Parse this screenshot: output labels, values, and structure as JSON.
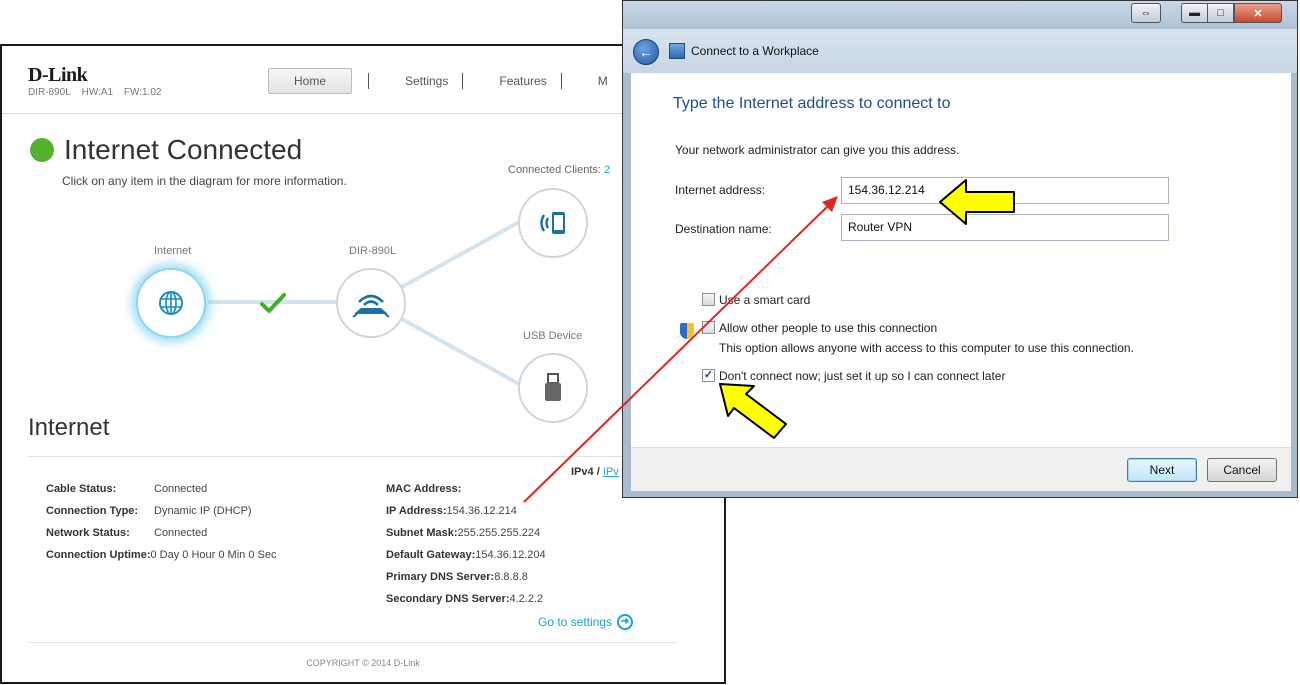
{
  "router": {
    "brand": "D-Link",
    "model": "DIR-890L",
    "hw": "HW:A1",
    "fw": "FW:1.02",
    "nav": [
      "Home",
      "Settings",
      "Features",
      "M"
    ],
    "status_title": "Internet Connected",
    "hint": "Click on any item in the diagram for more information.",
    "connected_clients_label": "Connected Clients:",
    "connected_clients_count": "2",
    "diagram": {
      "internet_label": "Internet",
      "router_label": "DIR-890L",
      "usb_label": "USB Device"
    },
    "section_title": "Internet",
    "ipv4": "IPv4",
    "ipv_sep": "/",
    "ipv6": "IPv",
    "left_info": [
      {
        "k": "Cable Status:",
        "v": "Connected"
      },
      {
        "k": "Connection Type:",
        "v": "Dynamic IP (DHCP)"
      },
      {
        "k": "Network Status:",
        "v": "Connected"
      },
      {
        "k": "Connection Uptime:",
        "v": "0 Day 0 Hour 0 Min 0 Sec"
      }
    ],
    "right_info": [
      {
        "k": "MAC Address:",
        "v": ""
      },
      {
        "k": "IP Address:",
        "v": "154.36.12.214"
      },
      {
        "k": "Subnet Mask:",
        "v": "255.255.255.224"
      },
      {
        "k": "Default Gateway:",
        "v": "154.36.12.204"
      },
      {
        "k": "Primary DNS Server:",
        "v": "8.8.8.8"
      },
      {
        "k": "Secondary DNS Server:",
        "v": "4.2.2.2"
      }
    ],
    "settings_link": "Go to settings",
    "copyright": "COPYRIGHT © 2014 D-Link"
  },
  "dialog": {
    "title": "Connect to a Workplace",
    "heading": "Type the Internet address to connect to",
    "subtext": "Your network administrator can give you this address.",
    "internet_address_label": "Internet address:",
    "internet_address_value": "154.36.12.214",
    "destination_name_label": "Destination name:",
    "destination_name_value": "Router VPN",
    "smart_card_label": "Use a smart card",
    "allow_others_label": "Allow other people to use this connection",
    "allow_others_desc": "This option allows anyone with access to this computer to use this connection.",
    "dont_connect_label": "Don't connect now; just set it up so I can connect later",
    "next_label": "Next",
    "cancel_label": "Cancel"
  },
  "colors": {
    "status_green": "#54b22d",
    "dlink_blue": "#1a9fd9",
    "annotation_red": "#e0261f",
    "arrow_yellow": "#ffff00"
  }
}
